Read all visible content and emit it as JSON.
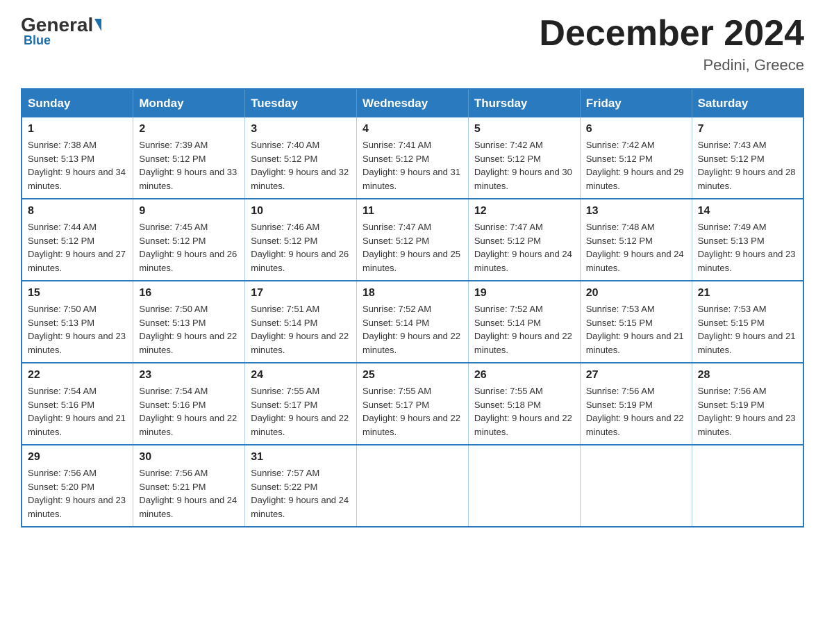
{
  "header": {
    "logo": {
      "general": "General",
      "blue": "Blue",
      "triangle": "▶"
    },
    "title": "December 2024",
    "location": "Pedini, Greece"
  },
  "calendar": {
    "days_of_week": [
      "Sunday",
      "Monday",
      "Tuesday",
      "Wednesday",
      "Thursday",
      "Friday",
      "Saturday"
    ],
    "weeks": [
      [
        {
          "day": "1",
          "sunrise": "7:38 AM",
          "sunset": "5:13 PM",
          "daylight": "9 hours and 34 minutes."
        },
        {
          "day": "2",
          "sunrise": "7:39 AM",
          "sunset": "5:12 PM",
          "daylight": "9 hours and 33 minutes."
        },
        {
          "day": "3",
          "sunrise": "7:40 AM",
          "sunset": "5:12 PM",
          "daylight": "9 hours and 32 minutes."
        },
        {
          "day": "4",
          "sunrise": "7:41 AM",
          "sunset": "5:12 PM",
          "daylight": "9 hours and 31 minutes."
        },
        {
          "day": "5",
          "sunrise": "7:42 AM",
          "sunset": "5:12 PM",
          "daylight": "9 hours and 30 minutes."
        },
        {
          "day": "6",
          "sunrise": "7:42 AM",
          "sunset": "5:12 PM",
          "daylight": "9 hours and 29 minutes."
        },
        {
          "day": "7",
          "sunrise": "7:43 AM",
          "sunset": "5:12 PM",
          "daylight": "9 hours and 28 minutes."
        }
      ],
      [
        {
          "day": "8",
          "sunrise": "7:44 AM",
          "sunset": "5:12 PM",
          "daylight": "9 hours and 27 minutes."
        },
        {
          "day": "9",
          "sunrise": "7:45 AM",
          "sunset": "5:12 PM",
          "daylight": "9 hours and 26 minutes."
        },
        {
          "day": "10",
          "sunrise": "7:46 AM",
          "sunset": "5:12 PM",
          "daylight": "9 hours and 26 minutes."
        },
        {
          "day": "11",
          "sunrise": "7:47 AM",
          "sunset": "5:12 PM",
          "daylight": "9 hours and 25 minutes."
        },
        {
          "day": "12",
          "sunrise": "7:47 AM",
          "sunset": "5:12 PM",
          "daylight": "9 hours and 24 minutes."
        },
        {
          "day": "13",
          "sunrise": "7:48 AM",
          "sunset": "5:12 PM",
          "daylight": "9 hours and 24 minutes."
        },
        {
          "day": "14",
          "sunrise": "7:49 AM",
          "sunset": "5:13 PM",
          "daylight": "9 hours and 23 minutes."
        }
      ],
      [
        {
          "day": "15",
          "sunrise": "7:50 AM",
          "sunset": "5:13 PM",
          "daylight": "9 hours and 23 minutes."
        },
        {
          "day": "16",
          "sunrise": "7:50 AM",
          "sunset": "5:13 PM",
          "daylight": "9 hours and 22 minutes."
        },
        {
          "day": "17",
          "sunrise": "7:51 AM",
          "sunset": "5:14 PM",
          "daylight": "9 hours and 22 minutes."
        },
        {
          "day": "18",
          "sunrise": "7:52 AM",
          "sunset": "5:14 PM",
          "daylight": "9 hours and 22 minutes."
        },
        {
          "day": "19",
          "sunrise": "7:52 AM",
          "sunset": "5:14 PM",
          "daylight": "9 hours and 22 minutes."
        },
        {
          "day": "20",
          "sunrise": "7:53 AM",
          "sunset": "5:15 PM",
          "daylight": "9 hours and 21 minutes."
        },
        {
          "day": "21",
          "sunrise": "7:53 AM",
          "sunset": "5:15 PM",
          "daylight": "9 hours and 21 minutes."
        }
      ],
      [
        {
          "day": "22",
          "sunrise": "7:54 AM",
          "sunset": "5:16 PM",
          "daylight": "9 hours and 21 minutes."
        },
        {
          "day": "23",
          "sunrise": "7:54 AM",
          "sunset": "5:16 PM",
          "daylight": "9 hours and 22 minutes."
        },
        {
          "day": "24",
          "sunrise": "7:55 AM",
          "sunset": "5:17 PM",
          "daylight": "9 hours and 22 minutes."
        },
        {
          "day": "25",
          "sunrise": "7:55 AM",
          "sunset": "5:17 PM",
          "daylight": "9 hours and 22 minutes."
        },
        {
          "day": "26",
          "sunrise": "7:55 AM",
          "sunset": "5:18 PM",
          "daylight": "9 hours and 22 minutes."
        },
        {
          "day": "27",
          "sunrise": "7:56 AM",
          "sunset": "5:19 PM",
          "daylight": "9 hours and 22 minutes."
        },
        {
          "day": "28",
          "sunrise": "7:56 AM",
          "sunset": "5:19 PM",
          "daylight": "9 hours and 23 minutes."
        }
      ],
      [
        {
          "day": "29",
          "sunrise": "7:56 AM",
          "sunset": "5:20 PM",
          "daylight": "9 hours and 23 minutes."
        },
        {
          "day": "30",
          "sunrise": "7:56 AM",
          "sunset": "5:21 PM",
          "daylight": "9 hours and 24 minutes."
        },
        {
          "day": "31",
          "sunrise": "7:57 AM",
          "sunset": "5:22 PM",
          "daylight": "9 hours and 24 minutes."
        },
        null,
        null,
        null,
        null
      ]
    ]
  }
}
